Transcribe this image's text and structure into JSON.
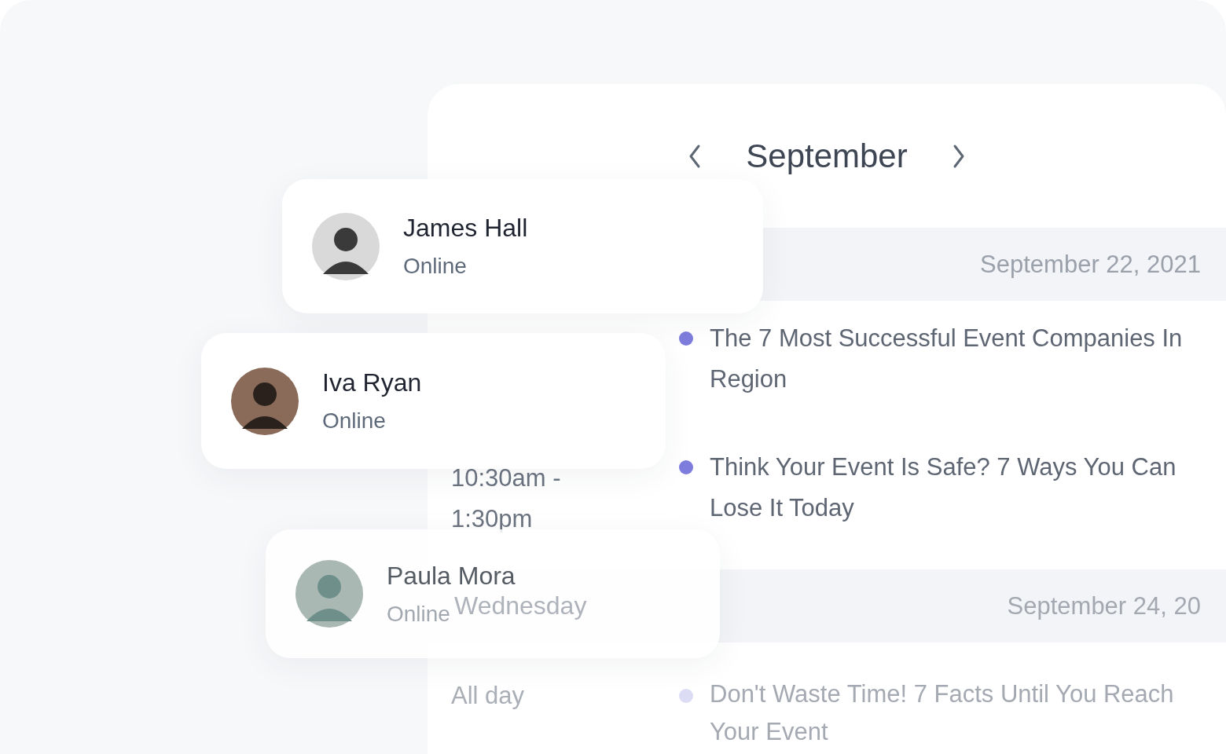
{
  "calendar": {
    "month": "September",
    "days": [
      {
        "date": "September 22, 2021",
        "events": [
          {
            "title": "The 7 Most Successful Event Companies In Region"
          },
          {
            "time": "10:30am - 1:30pm",
            "title": "Think Your Event Is Safe? 7 Ways You Can Lose It Today"
          }
        ]
      },
      {
        "weekday": "Wednesday",
        "date": "September 24, 20",
        "events": [
          {
            "time": "All day",
            "title": "Don't Waste Time! 7 Facts Until You Reach Your Event"
          }
        ]
      }
    ]
  },
  "contacts": [
    {
      "name": "James Hall",
      "status": "Online"
    },
    {
      "name": "Iva Ryan",
      "status": "Online"
    },
    {
      "name": "Paula Mora",
      "status": "Online"
    }
  ]
}
